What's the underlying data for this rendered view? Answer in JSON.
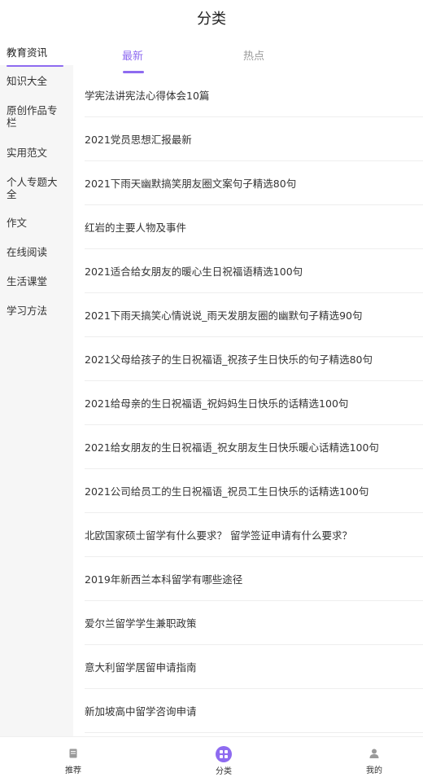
{
  "header": {
    "title": "分类"
  },
  "sidebar": {
    "items": [
      {
        "label": "教育资讯",
        "active": true
      },
      {
        "label": "知识大全"
      },
      {
        "label": "原创作品专栏"
      },
      {
        "label": "实用范文"
      },
      {
        "label": "个人专题大全"
      },
      {
        "label": "作文"
      },
      {
        "label": "在线阅读"
      },
      {
        "label": "生活课堂"
      },
      {
        "label": "学习方法"
      }
    ]
  },
  "tabs": [
    {
      "label": "最新",
      "active": true
    },
    {
      "label": "热点"
    }
  ],
  "articles": [
    "学宪法讲宪法心得体会10篇",
    "2021党员思想汇报最新",
    "2021下雨天幽默搞笑朋友圈文案句子精选80句",
    "红岩的主要人物及事件",
    "2021适合给女朋友的暖心生日祝福语精选100句",
    "2021下雨天搞笑心情说说_雨天发朋友圈的幽默句子精选90句",
    "2021父母给孩子的生日祝福语_祝孩子生日快乐的句子精选80句",
    "2021给母亲的生日祝福语_祝妈妈生日快乐的话精选100句",
    "2021给女朋友的生日祝福语_祝女朋友生日快乐暖心话精选100句",
    "2021公司给员工的生日祝福语_祝员工生日快乐的话精选100句",
    "北欧国家硕士留学有什么要求？ 留学签证申请有什么要求？",
    "2019年新西兰本科留学有哪些途径",
    "爱尔兰留学学生兼职政策",
    "意大利留学居留申请指南",
    "新加坡高中留学咨询申请"
  ],
  "tabbar": [
    {
      "label": "推荐",
      "icon": "book-icon"
    },
    {
      "label": "分类",
      "icon": "grid-icon",
      "active": true
    },
    {
      "label": "我的",
      "icon": "user-icon"
    }
  ],
  "colors": {
    "accent": "#8e6bf0",
    "sidebar_bg": "#f6f6f6",
    "divider": "#eeeeee"
  }
}
